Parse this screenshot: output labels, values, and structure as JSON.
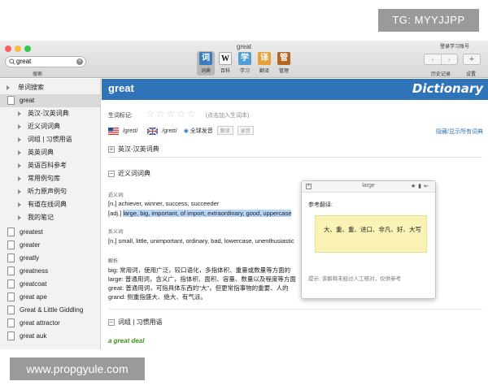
{
  "watermarks": {
    "top": "TG: MYYJJPP",
    "bottom": "www.propgyule.com"
  },
  "window": {
    "title": "great"
  },
  "search": {
    "value": "great",
    "caption": "搜索"
  },
  "toolbar": {
    "buttons": [
      {
        "label": "词典",
        "glyph": "词"
      },
      {
        "label": "百科",
        "glyph": "W"
      },
      {
        "label": "学习",
        "glyph": "学"
      },
      {
        "label": "翻译",
        "glyph": "译"
      },
      {
        "label": "管理",
        "glyph": "管"
      }
    ],
    "login": "登录学习账号",
    "history": "历史记录",
    "settings": "设置"
  },
  "sidebar": {
    "top_item": "单词搜索",
    "items": [
      "great",
      "英汉-汉英词典",
      "近义词词典",
      "词组 | 习惯用语",
      "英英词典",
      "英语百科参考",
      "常用例句库",
      "听力原声例句",
      "有道在线词典",
      "我的笔记",
      "greatest",
      "greater",
      "greatly",
      "greatness",
      "greatcoat",
      "great ape",
      "Great & Little Giddling",
      "great attractor",
      "great auk"
    ]
  },
  "main": {
    "word": "great",
    "logo": "Dictionary",
    "star_label": "生词标记:",
    "star_hint": "(点击加入生词本)",
    "pron_us": "/greɪt/",
    "pron_uk": "/greɪt/",
    "pron_all": "全球发音",
    "pron_btn1": "跟读",
    "pron_btn2": "录音",
    "toggle_link": "隐藏/显示所有词典",
    "section1": "英汉-汉英词典",
    "section2": "近义词词典",
    "syn_label": "近义词:",
    "syn_n": "[n.] achiever, winner, success, succeeder",
    "syn_adj_plain": "[adj.] ",
    "syn_adj_hl": "large, big, important, of import, extraordinary, good, uppercase",
    "ant_label": "反义词:",
    "ant_n": "[n.] small, little, unimportant, ordinary, bad, lowercase, unenthusiastic",
    "explain_label": "解析:",
    "explain_lines": [
      "big: 常用词，使用广泛，较口语化，多指体积、重量或数量等方面的",
      "large: 普通用词，含义广，指体积、面积、容量、数量以及程度等方面",
      "great: 普通用词，可指具体东西的\"大\"，但更常指事物的重要、人的",
      "grand: 侧重指盛大、绝大、有气派。"
    ],
    "section3": "词组 | 习惯用语",
    "phrase": "a great deal"
  },
  "popup": {
    "title": "large",
    "ref_label": "参考翻译:",
    "translation": "大、重、重、进口、非凡、好、大写",
    "hint": "提示: 该解释未经过人工核对，仅供参考"
  }
}
